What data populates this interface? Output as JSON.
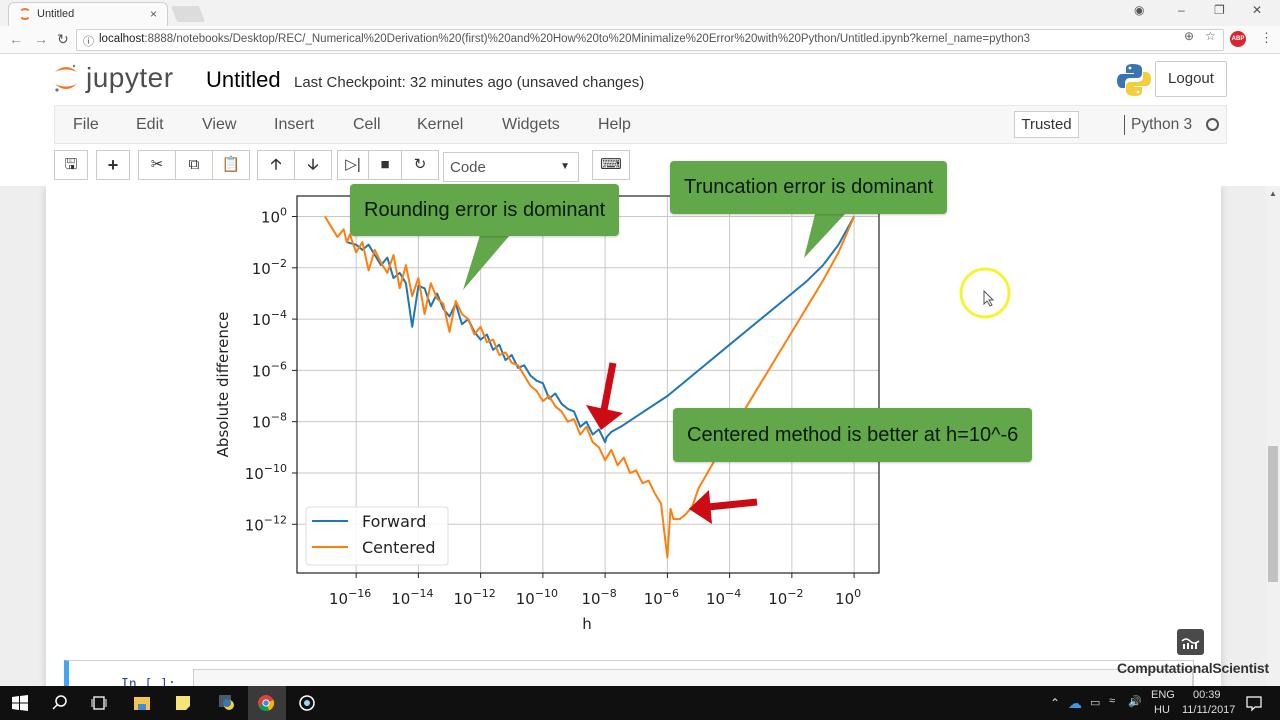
{
  "browser": {
    "tab_title": "Untitled",
    "tab_close": "×",
    "url_host": "localhost",
    "url_rest": ":8888/notebooks/Desktop/REC/_Numerical%20Derivation%20(first)%20and%20How%20to%20Minimalize%20Error%20with%20Python/Untitled.ipynb?kernel_name=python3",
    "icons": [
      "back-arrow",
      "forward-arrow",
      "reload",
      "info",
      "zoom",
      "star",
      "adblock-plus",
      "menu-kebab",
      "account",
      "minimize",
      "restore",
      "close"
    ],
    "abp_label": "ABP"
  },
  "jupyter": {
    "logo_text": "jupyter",
    "notebook_title": "Untitled",
    "checkpoint": "Last Checkpoint: 32 minutes ago (unsaved changes)",
    "logout_label": "Logout",
    "menu": [
      "File",
      "Edit",
      "View",
      "Insert",
      "Cell",
      "Kernel",
      "Widgets",
      "Help"
    ],
    "trusted_label": "Trusted",
    "kernel_name": "Python 3",
    "toolbar": {
      "buttons": [
        "save",
        "insert-cell-below",
        "cut",
        "copy",
        "paste",
        "move-up",
        "move-down",
        "run",
        "interrupt",
        "restart",
        "command-palette"
      ],
      "cell_type": "Code"
    },
    "next_cell_prompt": "In [ ]:"
  },
  "chart_data": {
    "type": "line",
    "title": "",
    "xlabel": "h",
    "ylabel": "Absolute difference",
    "xscale": "log",
    "yscale": "log",
    "xlim_exp": [
      -17.9,
      0.8
    ],
    "ylim_exp": [
      -13.9,
      0.8
    ],
    "xticks": [
      {
        "exp": -16,
        "label": "10",
        "sup": "−16"
      },
      {
        "exp": -14,
        "label": "10",
        "sup": "−14"
      },
      {
        "exp": -12,
        "label": "10",
        "sup": "−12"
      },
      {
        "exp": -10,
        "label": "10",
        "sup": "−10"
      },
      {
        "exp": -8,
        "label": "10",
        "sup": "−8"
      },
      {
        "exp": -6,
        "label": "10",
        "sup": "−6"
      },
      {
        "exp": -4,
        "label": "10",
        "sup": "−4"
      },
      {
        "exp": -2,
        "label": "10",
        "sup": "−2"
      },
      {
        "exp": 0,
        "label": "10",
        "sup": "0"
      }
    ],
    "yticks": [
      {
        "exp": 0,
        "label": "10",
        "sup": "0"
      },
      {
        "exp": -2,
        "label": "10",
        "sup": "−2"
      },
      {
        "exp": -4,
        "label": "10",
        "sup": "−4"
      },
      {
        "exp": -6,
        "label": "10",
        "sup": "−6"
      },
      {
        "exp": -8,
        "label": "10",
        "sup": "−8"
      },
      {
        "exp": -10,
        "label": "10",
        "sup": "−10"
      },
      {
        "exp": -12,
        "label": "10",
        "sup": "−12"
      }
    ],
    "grid": true,
    "legend_position": "lower-left",
    "series": [
      {
        "name": "Forward",
        "color": "#1f77b4",
        "x_log10": [
          -16.3,
          -16.0,
          -15.8,
          -15.6,
          -15.4,
          -15.2,
          -15.0,
          -14.8,
          -14.6,
          -14.4,
          -14.2,
          -14.0,
          -13.8,
          -13.6,
          -13.4,
          -13.2,
          -13.0,
          -12.8,
          -12.6,
          -12.4,
          -12.2,
          -12.0,
          -11.8,
          -11.6,
          -11.4,
          -11.2,
          -11.0,
          -10.8,
          -10.6,
          -10.4,
          -10.2,
          -10.0,
          -9.8,
          -9.6,
          -9.4,
          -9.2,
          -9.0,
          -8.8,
          -8.6,
          -8.4,
          -8.2,
          -8.0,
          -7.95,
          -7.8,
          -7.5,
          -7.0,
          -6.0,
          -5.0,
          -4.0,
          -3.0,
          -2.0,
          -1.5,
          -1.0,
          -0.5,
          0.0
        ],
        "y_log10": [
          -1.0,
          -1.1,
          -1.3,
          -1.1,
          -1.5,
          -1.9,
          -1.6,
          -2.4,
          -2.2,
          -2.6,
          -4.3,
          -2.7,
          -2.8,
          -3.5,
          -3.0,
          -3.6,
          -3.9,
          -3.4,
          -4.2,
          -4.0,
          -4.5,
          -4.8,
          -4.6,
          -5.2,
          -5.0,
          -5.6,
          -5.4,
          -5.9,
          -5.8,
          -6.2,
          -6.4,
          -6.5,
          -7.1,
          -6.9,
          -7.3,
          -7.5,
          -7.6,
          -8.2,
          -8.0,
          -8.5,
          -8.3,
          -8.8,
          -8.6,
          -8.4,
          -8.2,
          -7.8,
          -7.0,
          -6.0,
          -5.0,
          -4.0,
          -3.0,
          -2.5,
          -1.9,
          -1.1,
          0.0
        ]
      },
      {
        "name": "Centered",
        "color": "#ff7f0e",
        "x_log10": [
          -17.0,
          -16.8,
          -16.6,
          -16.4,
          -16.3,
          -16.2,
          -16.0,
          -15.8,
          -15.6,
          -15.4,
          -15.2,
          -15.0,
          -14.8,
          -14.6,
          -14.4,
          -14.2,
          -14.0,
          -13.8,
          -13.6,
          -13.4,
          -13.2,
          -13.0,
          -12.8,
          -12.6,
          -12.4,
          -12.2,
          -12.0,
          -11.8,
          -11.6,
          -11.4,
          -11.2,
          -11.0,
          -10.8,
          -10.6,
          -10.4,
          -10.2,
          -10.0,
          -9.8,
          -9.6,
          -9.4,
          -9.2,
          -9.0,
          -8.8,
          -8.6,
          -8.4,
          -8.2,
          -8.0,
          -7.8,
          -7.6,
          -7.4,
          -7.2,
          -7.0,
          -6.8,
          -6.6,
          -6.4,
          -6.2,
          -6.1,
          -6.0,
          -5.9,
          -5.8,
          -5.6,
          -5.4,
          -5.2,
          -5.0,
          -4.0,
          -3.0,
          -2.0,
          -1.5,
          -1.0,
          -0.5,
          0.0
        ],
        "y_log10": [
          0.0,
          -0.4,
          -0.8,
          -0.5,
          -1.0,
          -0.7,
          -1.4,
          -1.0,
          -2.1,
          -1.3,
          -1.8,
          -2.2,
          -1.5,
          -2.8,
          -1.9,
          -3.1,
          -2.4,
          -3.8,
          -2.6,
          -3.2,
          -3.4,
          -4.5,
          -3.3,
          -3.8,
          -4.0,
          -4.6,
          -4.3,
          -4.9,
          -4.8,
          -5.4,
          -5.3,
          -5.7,
          -5.8,
          -6.2,
          -6.6,
          -6.8,
          -7.2,
          -7.0,
          -7.4,
          -7.6,
          -8.0,
          -7.9,
          -8.5,
          -8.2,
          -8.8,
          -9.0,
          -9.5,
          -9.1,
          -9.7,
          -9.4,
          -10.0,
          -9.9,
          -10.4,
          -10.3,
          -10.8,
          -11.2,
          -12.3,
          -13.3,
          -11.4,
          -11.8,
          -11.8,
          -11.6,
          -11.3,
          -10.6,
          -8.5,
          -6.5,
          -4.5,
          -3.5,
          -2.5,
          -1.4,
          0.0
        ]
      }
    ],
    "annotations": [
      {
        "text": "Rounding error is dominant",
        "style": "green-callout"
      },
      {
        "text": "Truncation error is dominant",
        "style": "green-callout"
      },
      {
        "text": "Centered method is better at h=10^-6",
        "style": "green-callout"
      },
      {
        "text": "",
        "style": "red-arrow",
        "points_to": "Forward minimum near h=10^-8"
      },
      {
        "text": "",
        "style": "red-arrow",
        "points_to": "Centered minimum near h=10^-6"
      }
    ]
  },
  "watermark": "ComputationalScientist",
  "taskbar": {
    "apps": [
      "start",
      "search",
      "task-view",
      "file-explorer",
      "sticky-notes",
      "python-idle",
      "chrome",
      "cortana-circle"
    ],
    "lang_top": "ENG",
    "lang_bottom": "HU",
    "time": "00:39",
    "date": "11/11/2017"
  }
}
